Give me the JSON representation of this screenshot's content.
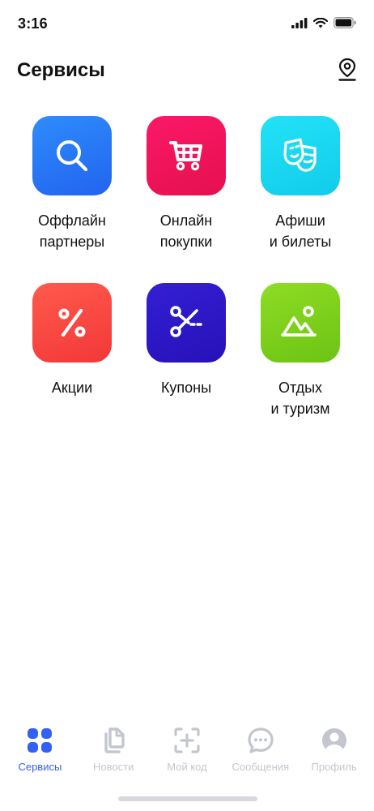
{
  "status": {
    "time": "3:16"
  },
  "header": {
    "title": "Сервисы"
  },
  "tiles": [
    {
      "label": "Оффлайн\nпартнеры",
      "icon": "search-icon",
      "color": "#2c7df6"
    },
    {
      "label": "Онлайн\nпокупки",
      "icon": "cart-icon",
      "color": "#f2155e"
    },
    {
      "label": "Афиши\nи билеты",
      "icon": "theater-masks-icon",
      "color": "#1ad8f0"
    },
    {
      "label": "Акции",
      "icon": "percent-icon",
      "color": "#fb4545"
    },
    {
      "label": "Купоны",
      "icon": "scissors-icon",
      "color": "#2d19c9"
    },
    {
      "label": "Отдых\nи туризм",
      "icon": "mountains-icon",
      "color": "#7dd31c"
    }
  ],
  "tabbar": [
    {
      "label": "Сервисы",
      "icon": "grid-icon",
      "active": true
    },
    {
      "label": "Новости",
      "icon": "news-icon",
      "active": false
    },
    {
      "label": "Мой код",
      "icon": "qr-add-icon",
      "active": false
    },
    {
      "label": "Сообщения",
      "icon": "chat-icon",
      "active": false
    },
    {
      "label": "Профиль",
      "icon": "profile-icon",
      "active": false
    }
  ],
  "colors": {
    "accent": "#3161f5",
    "inactive": "#c3c6ce"
  }
}
